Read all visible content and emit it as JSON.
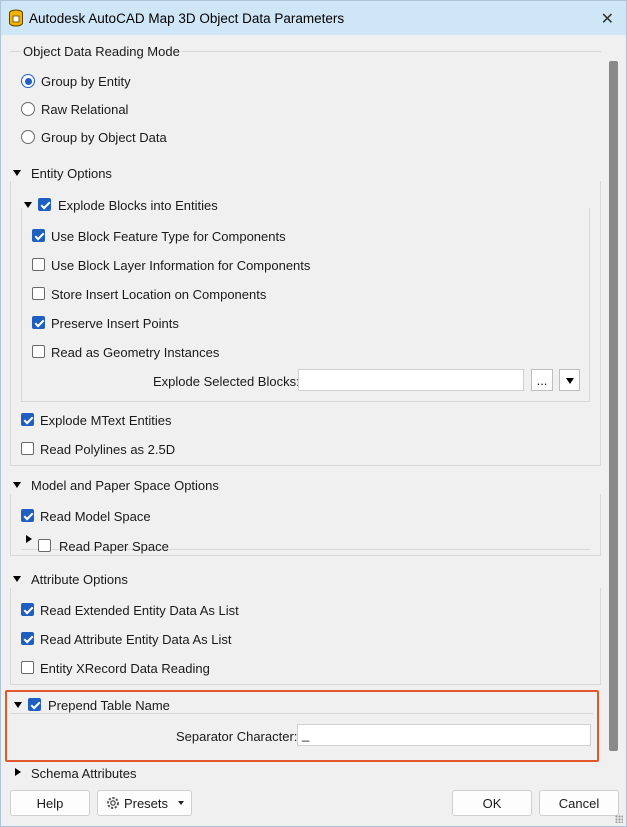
{
  "window": {
    "title": "Autodesk AutoCAD Map 3D Object Data Parameters",
    "close_icon": "close-icon",
    "app_icon": "database-icon"
  },
  "reading_mode": {
    "title": "Object Data Reading Mode",
    "options": [
      {
        "label": "Group by Entity",
        "selected": true
      },
      {
        "label": "Raw Relational",
        "selected": false
      },
      {
        "label": "Group by Object Data",
        "selected": false
      }
    ]
  },
  "entity_options": {
    "title": "Entity Options",
    "explode_blocks": {
      "label": "Explode Blocks into Entities",
      "checked": true,
      "items": [
        {
          "label": "Use Block Feature Type for Components",
          "checked": true
        },
        {
          "label": "Use Block Layer Information for Components",
          "checked": false
        },
        {
          "label": "Store Insert Location on Components",
          "checked": false
        },
        {
          "label": "Preserve Insert Points",
          "checked": true
        },
        {
          "label": "Read as Geometry Instances",
          "checked": false
        }
      ],
      "selected_blocks_label": "Explode Selected Blocks:",
      "selected_blocks_value": "",
      "browse_label": "..."
    },
    "explode_mtext": {
      "label": "Explode MText Entities",
      "checked": true
    },
    "polylines_25d": {
      "label": "Read Polylines as 2.5D",
      "checked": false
    }
  },
  "model_paper": {
    "title": "Model and Paper Space Options",
    "read_model": {
      "label": "Read Model Space",
      "checked": true
    },
    "read_paper": {
      "label": "Read Paper Space",
      "checked": false
    }
  },
  "attribute_options": {
    "title": "Attribute Options",
    "items": [
      {
        "label": "Read Extended Entity Data As List",
        "checked": true
      },
      {
        "label": "Read Attribute Entity Data As List",
        "checked": true
      },
      {
        "label": "Entity XRecord Data Reading",
        "checked": false
      }
    ]
  },
  "prepend": {
    "label": "Prepend Table Name",
    "checked": true,
    "separator_label": "Separator Character:",
    "separator_value": "_"
  },
  "schema": {
    "title": "Schema Attributes"
  },
  "footer": {
    "help_label": "Help",
    "presets_label": "Presets",
    "ok_label": "OK",
    "cancel_label": "Cancel"
  },
  "colors": {
    "accent": "#1f5fbf",
    "titlebar": "#cfe6f7",
    "highlight": "#e2582b"
  }
}
